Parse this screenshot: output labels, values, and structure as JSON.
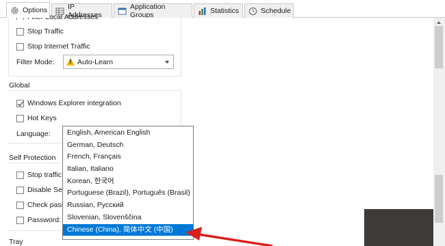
{
  "tabs": [
    {
      "label": "Options",
      "icon": "gear-icon",
      "active": true
    },
    {
      "label": "IP Addresses",
      "icon": "ip-grid-icon",
      "active": false
    },
    {
      "label": "Application Groups",
      "icon": "window-icon",
      "active": false
    },
    {
      "label": "Statistics",
      "icon": "bar-chart-icon",
      "active": false
    },
    {
      "label": "Schedule",
      "icon": "clock-icon",
      "active": false
    }
  ],
  "traffic": {
    "cut_row": "Filter Local Addresses",
    "stop_traffic": "Stop Traffic",
    "stop_internet": "Stop Internet Traffic",
    "filter_mode_label": "Filter Mode:",
    "filter_mode_value": "Auto-Learn"
  },
  "global": {
    "heading": "Global",
    "explorer": "Windows Explorer integration",
    "explorer_checked": true,
    "hotkeys": "Hot Keys",
    "language_label": "Language:"
  },
  "self_protection": {
    "heading": "Self Protection",
    "stop_traffic_w": "Stop traffic w",
    "disable_serv": "Disable Serv",
    "check_passw": "Check passw",
    "password_label": "Password:"
  },
  "tray": {
    "heading": "Tray"
  },
  "languages": [
    "English, American English",
    "German, Deutsch",
    "French, Français",
    "Italian, Italiano",
    "Korean, 한국어",
    "Portuguese (Brazil), Português (Brasil)",
    "Russian, Русский",
    "Slovenian, Slovenščina",
    "Chinese (China), 简体中文 (中国)"
  ],
  "selected_language": "Chinese (China), 简体中文 (中国)",
  "colors": {
    "selection": "#0078d7",
    "arrow": "#d9201c",
    "warning": "#f2b705"
  }
}
